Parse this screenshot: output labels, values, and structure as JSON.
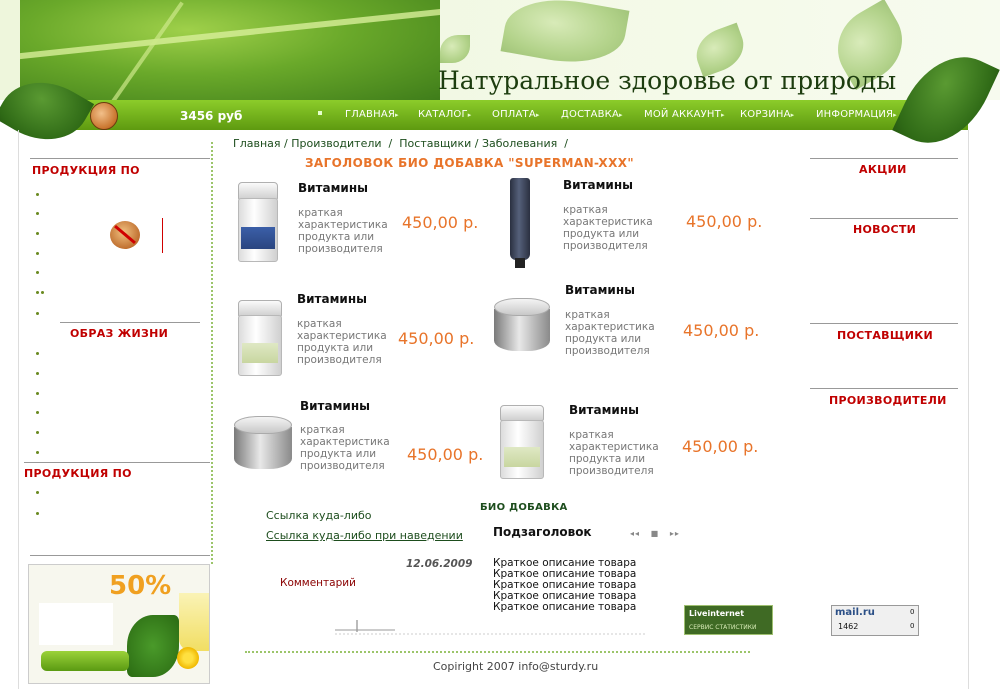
{
  "header": {
    "title": "Натуральное здоровье от природы"
  },
  "navbar": {
    "balance": "3456 руб",
    "items": [
      {
        "label": "ГЛАВНАЯ"
      },
      {
        "label": "КАТАЛОГ"
      },
      {
        "label": "ОПЛАТА"
      },
      {
        "label": "ДОСТАВКА"
      },
      {
        "label": "МОЙ АККАУНТ"
      },
      {
        "label": "КОРЗИНА"
      },
      {
        "label": "ИНФОРМАЦИЯ"
      }
    ]
  },
  "left_sidebar": {
    "section1_title": "ПРОДУКЦИЯ ПО",
    "section2_title": "ОБРАЗ ЖИЗНИ",
    "section3_title": "ПРОДУКЦИЯ ПО",
    "banner_percent": "50%"
  },
  "right_sidebar": {
    "sections": [
      "АКЦИИ",
      "НОВОСТИ",
      "ПОСТАВЩИКИ",
      "ПРОИЗВОДИТЕЛИ"
    ]
  },
  "breadcrumb": {
    "items": [
      "Главная",
      "Производители",
      "Поставщики",
      "Заболевания"
    ],
    "separator": "/"
  },
  "products_header": "ЗАГОЛОВОК БИО ДОБАВКА \"SUPERMAN-XXX\"",
  "products": [
    {
      "name": "Витамины",
      "description": "краткая характеристика продукта или производителя",
      "price": "450,00 р."
    },
    {
      "name": "Витамины",
      "description": "краткая характеристика продукта или производителя",
      "price": "450,00 р."
    },
    {
      "name": "Витамины",
      "description": "краткая характеристика продукта или производителя",
      "price": "450,00 р."
    },
    {
      "name": "Витамины",
      "description": "краткая характеристика продукта или производителя",
      "price": "450,00 р."
    },
    {
      "name": "Витамины",
      "description": "краткая характеристика продукта или производителя",
      "price": "450,00 р."
    },
    {
      "name": "Витамины",
      "description": "краткая характеристика продукта или производителя",
      "price": "450,00 р."
    }
  ],
  "bio_section": {
    "title": "БИО ДОБАВКА",
    "link1": "Ссылка куда-либо",
    "link2": "Ссылка куда-либо при наведении",
    "subheader": "Подзаголовок",
    "date": "12.06.2009",
    "comment": "Комментарий",
    "description_lines": [
      "Краткое описание товара",
      "Краткое описание товара",
      "Краткое описание товара",
      "Краткое описание товара",
      "Краткое описание товара"
    ]
  },
  "counters": {
    "liveinternet_title": "Liveinternet",
    "liveinternet_sub": "СЕРВИС СТАТИСТИКИ",
    "mailru_logo": "mail.ru",
    "mailru_count": "1462",
    "mailru_zero1": "0",
    "mailru_zero2": "0"
  },
  "footer": {
    "copyright": "Copiright 2007 info@sturdy.ru"
  }
}
